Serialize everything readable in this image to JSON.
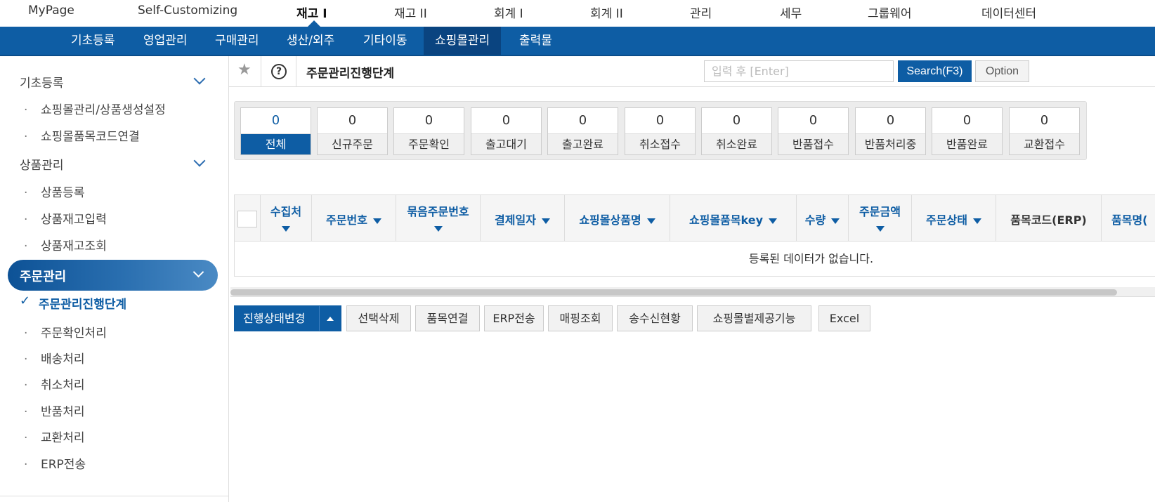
{
  "top_nav": [
    "MyPage",
    "Self-Customizing",
    "재고 I",
    "재고 II",
    "회계 I",
    "회계 II",
    "관리",
    "세무",
    "그룹웨어",
    "데이터센터"
  ],
  "top_nav_active": "재고 I",
  "sub_nav": [
    "기초등록",
    "영업관리",
    "구매관리",
    "생산/외주",
    "기타이동",
    "쇼핑몰관리",
    "출력물"
  ],
  "sub_nav_active": "쇼핑몰관리",
  "sidebar": {
    "groups": [
      {
        "label": "기초등록",
        "items": [
          "쇼핑몰관리/상품생성설정",
          "쇼핑몰품목코드연결"
        ]
      },
      {
        "label": "상품관리",
        "items": [
          "상품등록",
          "상품재고입력",
          "상품재고조회"
        ]
      },
      {
        "label": "주문관리",
        "current": "주문관리진행단계",
        "items": [
          "주문확인처리",
          "배송처리",
          "취소처리",
          "반품처리",
          "교환처리",
          "ERP전송"
        ]
      }
    ],
    "dot": "·",
    "check": "✓"
  },
  "header": {
    "title": "주문관리진행단계",
    "search_placeholder": "입력 후 [Enter]",
    "search_button": "Search(F3)",
    "option_button": "Option",
    "help": "?",
    "star": "★"
  },
  "status_tiles": [
    {
      "count": "0",
      "label": "전체",
      "selected": true
    },
    {
      "count": "0",
      "label": "신규주문"
    },
    {
      "count": "0",
      "label": "주문확인"
    },
    {
      "count": "0",
      "label": "출고대기"
    },
    {
      "count": "0",
      "label": "출고완료"
    },
    {
      "count": "0",
      "label": "취소접수"
    },
    {
      "count": "0",
      "label": "취소완료"
    },
    {
      "count": "0",
      "label": "반품접수"
    },
    {
      "count": "0",
      "label": "반품처리중"
    },
    {
      "count": "0",
      "label": "반품완료"
    },
    {
      "count": "0",
      "label": "교환접수"
    }
  ],
  "grid": {
    "columns": [
      "수집처",
      "주문번호",
      "묶음주문번호",
      "결제일자",
      "쇼핑몰상품명",
      "쇼핑몰품목key",
      "수량",
      "주문금액",
      "주문상태",
      "품목코드(ERP)",
      "품목명("
    ],
    "empty_message": "등록된 데이터가 없습니다."
  },
  "actions": [
    "진행상태변경",
    "선택삭제",
    "품목연결",
    "ERP전송",
    "매핑조회",
    "송수신현황",
    "쇼핑몰별제공기능",
    "Excel"
  ],
  "colors": {
    "primary": "#0e5da4",
    "sub_nav_active": "#0a4480"
  }
}
